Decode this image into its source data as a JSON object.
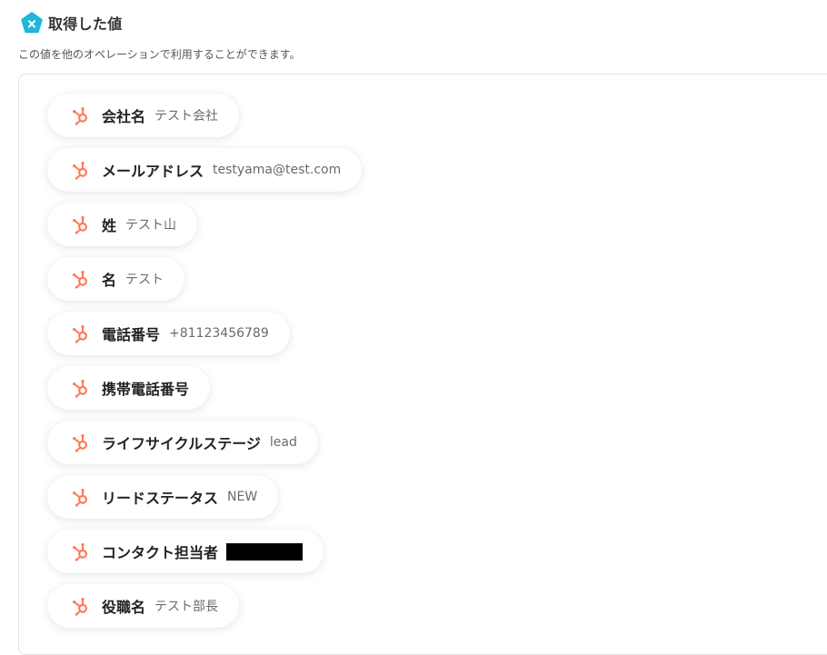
{
  "header": {
    "title": "取得した値",
    "subtitle": "この値を他のオペレーションで利用することができます。"
  },
  "fields": [
    {
      "label": "会社名",
      "value": "テスト会社"
    },
    {
      "label": "メールアドレス",
      "value": "testyama@test.com"
    },
    {
      "label": "姓",
      "value": "テスト山"
    },
    {
      "label": "名",
      "value": "テスト"
    },
    {
      "label": "電話番号",
      "value": "+81123456789"
    },
    {
      "label": "携帯電話番号",
      "value": ""
    },
    {
      "label": "ライフサイクルステージ",
      "value": "lead"
    },
    {
      "label": "リードステータス",
      "value": "NEW"
    },
    {
      "label": "コンタクト担当者",
      "value": "",
      "redacted": true
    },
    {
      "label": "役職名",
      "value": "テスト部長"
    }
  ],
  "colors": {
    "app_icon": "#1fb6d9",
    "hubspot_icon": "#ff7a59"
  },
  "icons": {
    "app": "x-pentagon-icon",
    "field": "hubspot-icon"
  }
}
